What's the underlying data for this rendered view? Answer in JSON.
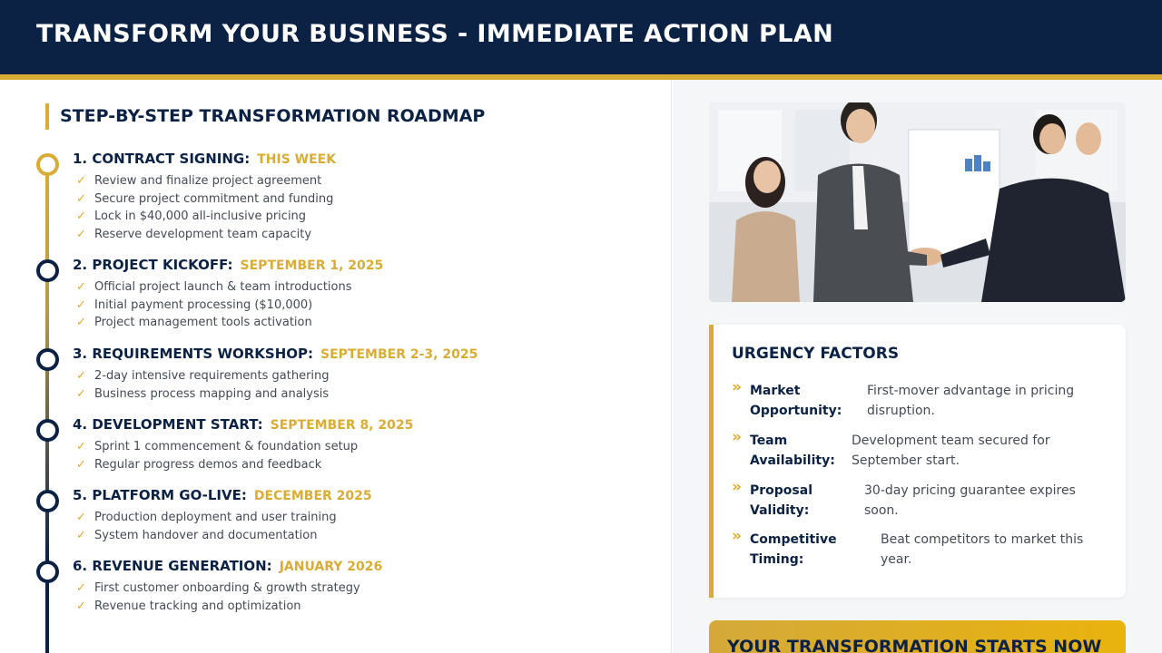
{
  "header": {
    "title": "TRANSFORM YOUR BUSINESS - IMMEDIATE ACTION PLAN"
  },
  "roadmap": {
    "heading": "STEP-BY-STEP TRANSFORMATION ROADMAP",
    "milestones": [
      {
        "title": "1. CONTRACT SIGNING:",
        "date": "THIS WEEK",
        "items": [
          "Review and finalize project agreement",
          "Secure project commitment and funding",
          "Lock in $40,000 all-inclusive pricing",
          "Reserve development team capacity"
        ]
      },
      {
        "title": "2. PROJECT KICKOFF:",
        "date": "SEPTEMBER 1, 2025",
        "items": [
          "Official project launch & team introductions",
          "Initial payment processing ($10,000)",
          "Project management tools activation"
        ]
      },
      {
        "title": "3. REQUIREMENTS WORKSHOP:",
        "date": "SEPTEMBER 2-3, 2025",
        "items": [
          "2-day intensive requirements gathering",
          "Business process mapping and analysis"
        ]
      },
      {
        "title": "4. DEVELOPMENT START:",
        "date": "SEPTEMBER 8, 2025",
        "items": [
          "Sprint 1 commencement & foundation setup",
          "Regular progress demos and feedback"
        ]
      },
      {
        "title": "5. PLATFORM GO-LIVE:",
        "date": "DECEMBER 2025",
        "items": [
          "Production deployment and user training",
          "System handover and documentation"
        ]
      },
      {
        "title": "6. REVENUE GENERATION:",
        "date": "JANUARY 2026",
        "items": [
          "First customer onboarding & growth strategy",
          "Revenue tracking and optimization"
        ]
      }
    ],
    "check_icon": "✓"
  },
  "urgency": {
    "title": "URGENCY FACTORS",
    "marker": "»",
    "factors": [
      {
        "label_line1": "Market",
        "label_line2": "Opportunity:",
        "text_line1": "First-mover advantage in pricing",
        "text_line2": "disruption."
      },
      {
        "label_line1": "Team",
        "label_line2": "Availability:",
        "text_line1": "Development team secured for",
        "text_line2": "September start."
      },
      {
        "label_line1": "Proposal",
        "label_line2": "Validity:",
        "text_line1": "30-day pricing guarantee expires",
        "text_line2": "soon."
      },
      {
        "label_line1": "Competitive",
        "label_line2": "Timing:",
        "text_line1": "Beat competitors to market this",
        "text_line2": "year."
      }
    ]
  },
  "cta": {
    "text": "YOUR TRANSFORMATION STARTS NOW"
  },
  "colors": {
    "navy": "#0c2244",
    "gold": "#d9ad35",
    "bright_gold": "#e9b30d"
  }
}
